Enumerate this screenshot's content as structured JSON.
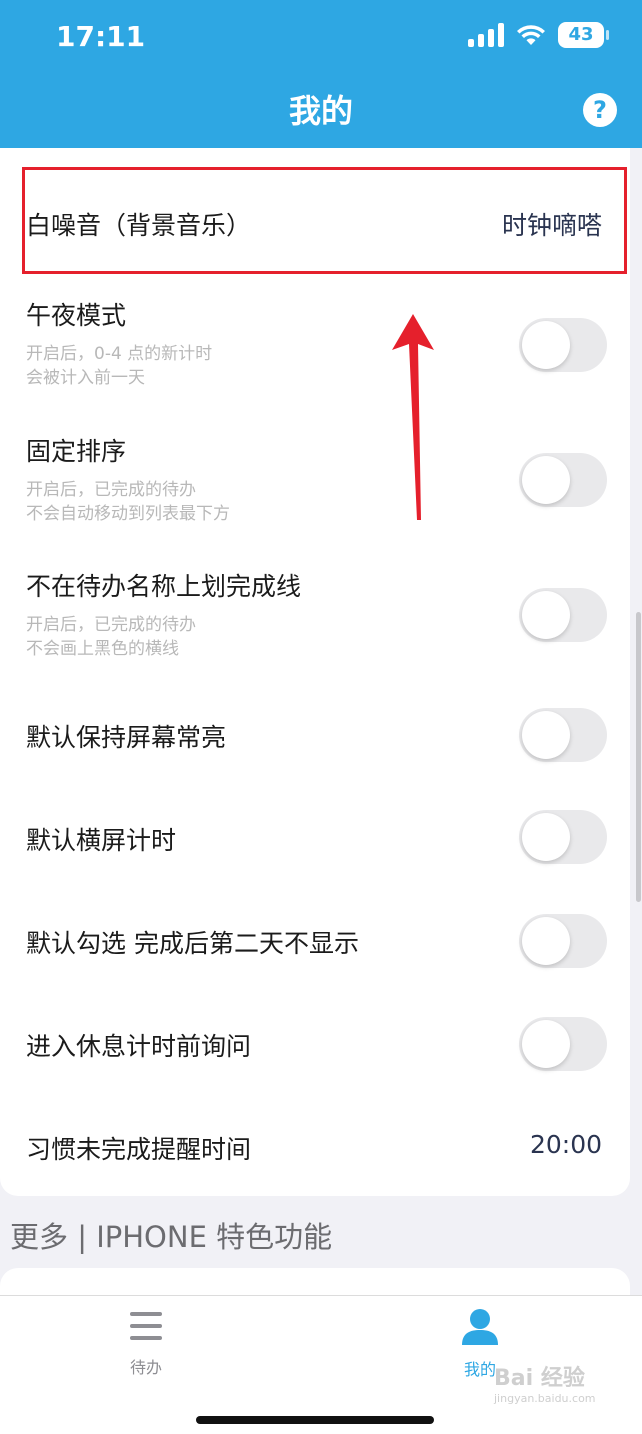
{
  "status_bar": {
    "time": "17:11",
    "battery": "43"
  },
  "header": {
    "title": "我的",
    "help_icon": "?"
  },
  "settings": [
    {
      "title": "白噪音（背景音乐）",
      "value": "时钟嘀嗒"
    },
    {
      "title": "午夜模式",
      "desc_line1": "开启后，0-4 点的新计时",
      "desc_line2": "会被计入前一天",
      "toggle": false
    },
    {
      "title": "固定排序",
      "desc_line1": "开启后，已完成的待办",
      "desc_line2": "不会自动移动到列表最下方",
      "toggle": false
    },
    {
      "title": "不在待办名称上划完成线",
      "desc_line1": "开启后，已完成的待办",
      "desc_line2": "不会画上黑色的横线",
      "toggle": false
    },
    {
      "title": "默认保持屏幕常亮",
      "toggle": false
    },
    {
      "title": "默认横屏计时",
      "toggle": false
    },
    {
      "title": "默认勾选 完成后第二天不显示",
      "toggle": false
    },
    {
      "title": "进入休息计时前询问",
      "toggle": false
    },
    {
      "title": "习惯未完成提醒时间",
      "value": "20:00"
    }
  ],
  "section": {
    "title": "更多 | IPHONE 特色功能"
  },
  "tabbar": {
    "todo_label": "待办",
    "mine_label": "我的"
  },
  "watermark": {
    "brand": "Bai 经验",
    "url": "jingyan.baidu.com"
  },
  "colors": {
    "accent": "#2ea7e3",
    "highlight": "#e5202c"
  }
}
